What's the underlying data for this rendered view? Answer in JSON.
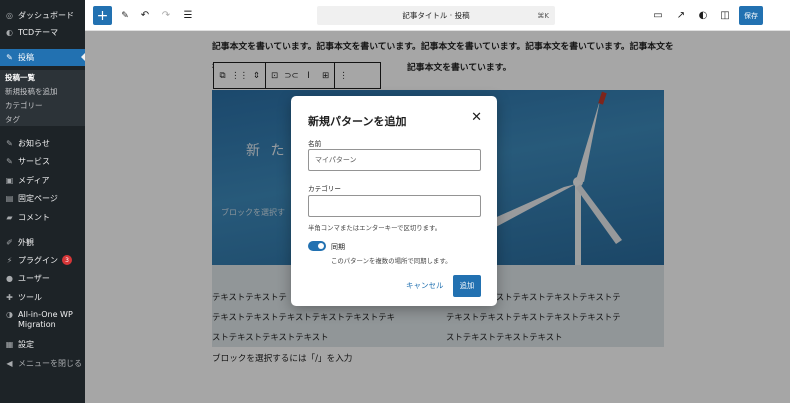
{
  "sidebar": {
    "items": [
      {
        "label": "ダッシュボード",
        "icon": "dashboard-icon",
        "glyph": "◎"
      },
      {
        "label": "TCDテーマ",
        "icon": "tcd-theme-icon",
        "glyph": "◐"
      },
      {
        "label": "投稿",
        "icon": "pin-icon",
        "glyph": "✎"
      },
      {
        "label": "お知らせ",
        "icon": "pin-icon",
        "glyph": "✎"
      },
      {
        "label": "サービス",
        "icon": "pin-icon",
        "glyph": "✎"
      },
      {
        "label": "メディア",
        "icon": "media-icon",
        "glyph": "▣"
      },
      {
        "label": "固定ページ",
        "icon": "page-icon",
        "glyph": "▤"
      },
      {
        "label": "コメント",
        "icon": "comment-icon",
        "glyph": "▰"
      },
      {
        "label": "外観",
        "icon": "appearance-icon",
        "glyph": "✐"
      },
      {
        "label": "プラグイン",
        "icon": "plugin-icon",
        "glyph": "⚡",
        "badge": "3"
      },
      {
        "label": "ユーザー",
        "icon": "user-icon",
        "glyph": "●"
      },
      {
        "label": "ツール",
        "icon": "tool-icon",
        "glyph": "✚"
      },
      {
        "label": "All-in-One WP",
        "label2": "Migration",
        "icon": "migration-icon",
        "glyph": "◑"
      },
      {
        "label": "設定",
        "icon": "settings-icon",
        "glyph": "▦"
      },
      {
        "label": "メニューを閉じる",
        "icon": "collapse-icon",
        "glyph": "◀"
      }
    ],
    "submenu": [
      "投稿一覧",
      "新規投稿を追加",
      "カテゴリー",
      "タグ"
    ]
  },
  "toolbar": {
    "add_icon": "+",
    "pen_icon": "✎",
    "undo_icon": "↶",
    "redo_icon": "↷",
    "list_icon": "☰",
    "doc_title": "記事タイトル · 投稿",
    "shortcut": "⌘K",
    "desktop_icon": "▭",
    "external_icon": "↗",
    "contrast_icon": "◐",
    "sidebar_icon": "◫",
    "save_label": "保存"
  },
  "content": {
    "paragraph1": "記事本文を書いています。記事本文を書いています。記事本文を書いています。記事本文を書いています。記事本文を",
    "paragraph2_start": "書",
    "paragraph2_end": "記事本文を書いています。",
    "cover_text": "新 た",
    "cover_placeholder": "ブロックを選択す",
    "col_left": [
      "テキストテキストテ",
      "テキストテキストテキストテキストテキストテキ",
      "ストテキストテキストテキスト"
    ],
    "col_right": [
      "テキストテキストテキストテキストテキストテ",
      "テキストテキストテキストテキストテキストテ",
      "ストテキストテキストテキスト"
    ],
    "footer_placeholder": "ブロックを選択するには「/」を入力"
  },
  "block_toolbar": [
    "⧉",
    "⋮⋮",
    "⇕",
    "⊡",
    "⊃⊂",
    "Ⅰ",
    "⊞",
    "⋮"
  ],
  "modal": {
    "title": "新規パターンを追加",
    "close_icon": "✕",
    "name_label": "名前",
    "name_value": "マイパターン",
    "category_label": "カテゴリー",
    "category_value": "",
    "category_hint": "半角コンマまたはエンターキーで区切ります。",
    "sync_label": "同期",
    "sync_on": true,
    "sync_hint": "このパターンを複数の場所で同期します。",
    "cancel_label": "キャンセル",
    "add_label": "追加",
    "accent_color": "#2271b1"
  }
}
